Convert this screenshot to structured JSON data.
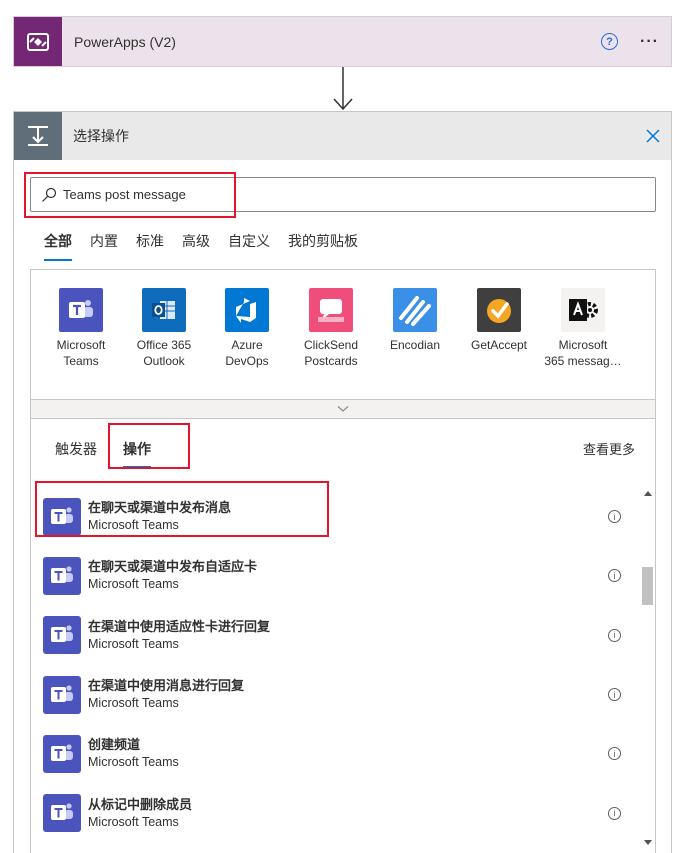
{
  "trigger": {
    "title": "PowerApps (V2)",
    "help_label": "?",
    "more_label": "···",
    "icon": "powerapps-icon"
  },
  "action": {
    "title": "选择操作",
    "icon": "action-icon",
    "close_icon": "close-icon"
  },
  "search": {
    "value": "Teams post message",
    "icon": "search-icon"
  },
  "filter_tabs": [
    {
      "label": "全部",
      "active": true
    },
    {
      "label": "内置",
      "active": false
    },
    {
      "label": "标准",
      "active": false
    },
    {
      "label": "高级",
      "active": false
    },
    {
      "label": "自定义",
      "active": false
    },
    {
      "label": "我的剪贴板",
      "active": false
    }
  ],
  "connectors": [
    {
      "line1": "Microsoft",
      "line2": "Teams",
      "icon": "teams-icon",
      "color": "#4b53bc"
    },
    {
      "line1": "Office 365",
      "line2": "Outlook",
      "icon": "outlook-icon",
      "color": "#0f6cbd"
    },
    {
      "line1": "Azure",
      "line2": "DevOps",
      "icon": "devops-icon",
      "color": "#0078d4"
    },
    {
      "line1": "ClickSend",
      "line2": "Postcards",
      "icon": "clicksend-icon",
      "color": "#f04e7a"
    },
    {
      "line1": "Encodian",
      "line2": "",
      "icon": "encodian-icon",
      "color": "#3a8fe6"
    },
    {
      "line1": "GetAccept",
      "line2": "",
      "icon": "getaccept-icon",
      "color": "#3f3f3f"
    },
    {
      "line1": "Microsoft",
      "line2": "365 messag…",
      "icon": "m365-message-icon",
      "color": "#f3f2f1"
    }
  ],
  "sub_tabs": [
    {
      "label": "触发器",
      "active": false
    },
    {
      "label": "操作",
      "active": true
    }
  ],
  "see_more": "查看更多",
  "results": [
    {
      "title": "在聊天或渠道中发布消息",
      "subtitle": "Microsoft Teams"
    },
    {
      "title": "在聊天或渠道中发布自适应卡",
      "subtitle": "Microsoft Teams"
    },
    {
      "title": "在渠道中使用适应性卡进行回复",
      "subtitle": "Microsoft Teams"
    },
    {
      "title": "在渠道中使用消息进行回复",
      "subtitle": "Microsoft Teams"
    },
    {
      "title": "创建频道",
      "subtitle": "Microsoft Teams"
    },
    {
      "title": "从标记中删除成员",
      "subtitle": "Microsoft Teams"
    }
  ],
  "info_label": "i",
  "colors": {
    "trigger_bg": "#ece2ec",
    "powerapps": "#742774",
    "teams": "#4b53bc",
    "highlight": "#e3152a",
    "accent": "#0078d4"
  }
}
